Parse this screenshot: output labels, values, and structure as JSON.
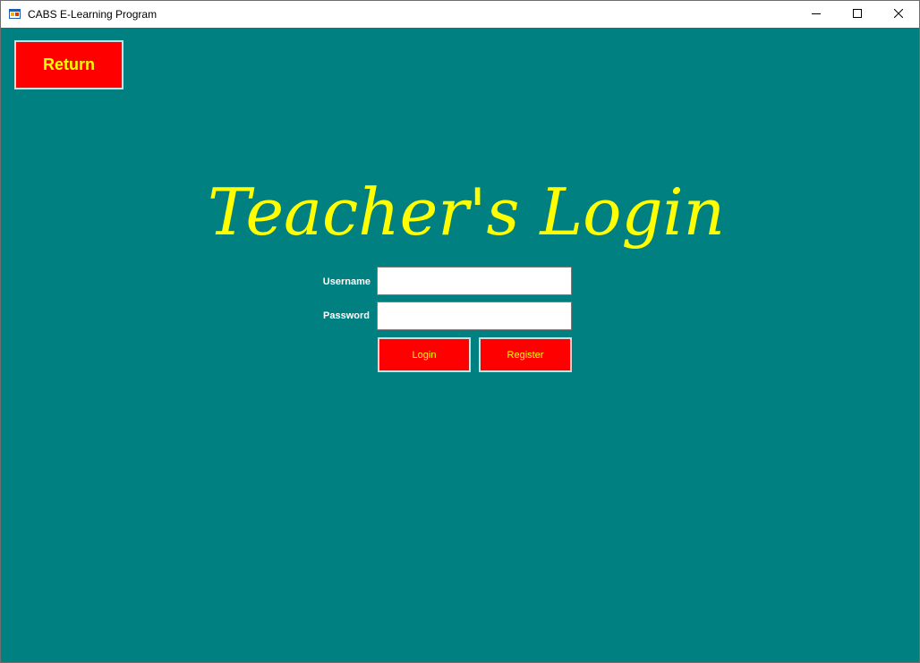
{
  "window": {
    "title": "CABS E-Learning Program",
    "icons": {
      "app": "app-window-icon",
      "minimize": "minimize-icon",
      "maximize": "maximize-icon",
      "close": "close-icon"
    }
  },
  "colors": {
    "background": "#008080",
    "button": "#ff0000",
    "button_text": "#ffff00",
    "heading": "#ffff00",
    "label": "#ffffff"
  },
  "toolbar": {
    "return_label": "Return"
  },
  "form": {
    "heading": "Teacher's Login",
    "username_label": "Username",
    "username_value": "",
    "password_label": "Password",
    "password_value": "",
    "login_label": "Login",
    "register_label": "Register"
  }
}
